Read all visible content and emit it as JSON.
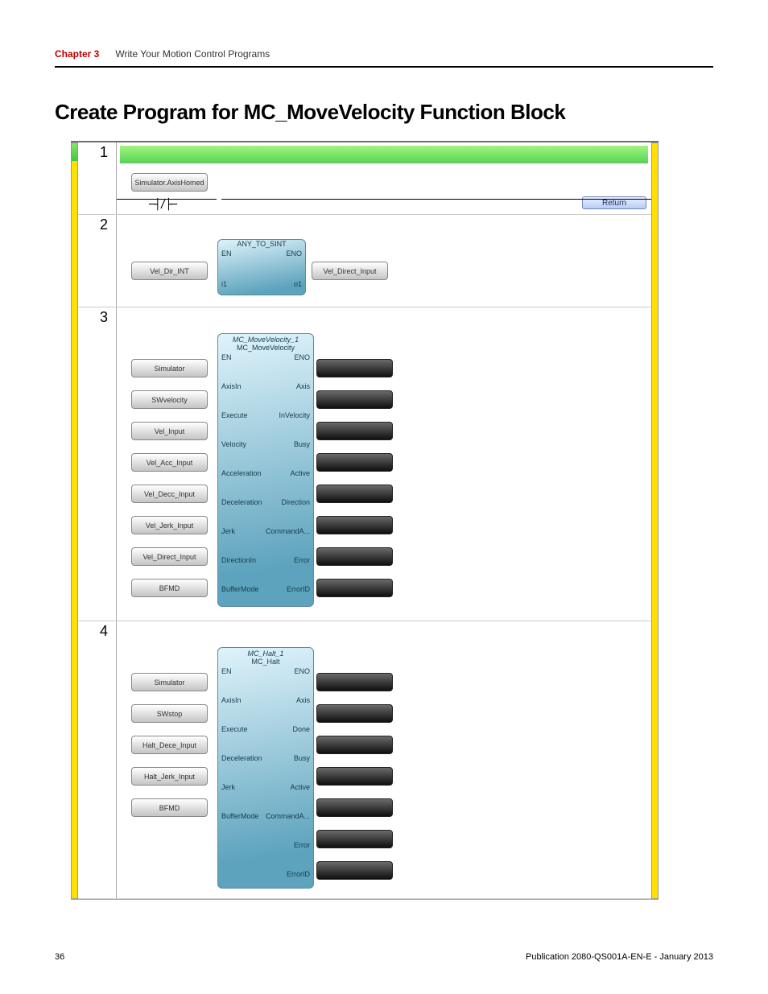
{
  "header": {
    "chapter": "Chapter 3",
    "title": "Write Your Motion Control Programs"
  },
  "heading": "Create Program for MC_MoveVelocity Function Block",
  "rungs": {
    "r1": {
      "num": "1",
      "tag": "Simulator.AxisHomed",
      "contact": "─┤/├─",
      "return": "Return"
    },
    "r2": {
      "num": "2",
      "in_tag": "Vel_Dir_INT",
      "out_tag": "Vel_Direct_Input",
      "fb_title": "ANY_TO_SINT",
      "pins": {
        "en": "EN",
        "eno": "ENO",
        "i1": "i1",
        "o1": "o1"
      }
    },
    "r3": {
      "num": "3",
      "fb_title1": "MC_MoveVelocity_1",
      "fb_title2": "MC_MoveVelocity",
      "inputs": [
        "Simulator",
        "SWvelocity",
        "Vel_Input",
        "Vel_Acc_Input",
        "Vel_Decc_Input",
        "Vel_Jerk_Input",
        "Vel_Direct_Input",
        "BFMD"
      ],
      "left_pins": [
        "EN",
        "AxisIn",
        "Execute",
        "Velocity",
        "Acceleration",
        "Deceleration",
        "Jerk",
        "DirectionIn",
        "BufferMode"
      ],
      "right_pins": [
        "ENO",
        "Axis",
        "InVelocity",
        "Busy",
        "Active",
        "Direction",
        "CommandA...",
        "Error",
        "ErrorID"
      ]
    },
    "r4": {
      "num": "4",
      "fb_title1": "MC_Halt_1",
      "fb_title2": "MC_Halt",
      "inputs": [
        "Simulator",
        "SWstop",
        "Halt_Dece_Input",
        "Halt_Jerk_Input",
        "BFMD"
      ],
      "left_pins": [
        "EN",
        "AxisIn",
        "Execute",
        "Deceleration",
        "Jerk",
        "BufferMode"
      ],
      "right_pins": [
        "ENO",
        "Axis",
        "Done",
        "Busy",
        "Active",
        "CommandA...",
        "Error",
        "ErrorID"
      ]
    }
  },
  "footer": {
    "page": "36",
    "pub": "Publication 2080-QS001A-EN-E - January 2013"
  }
}
